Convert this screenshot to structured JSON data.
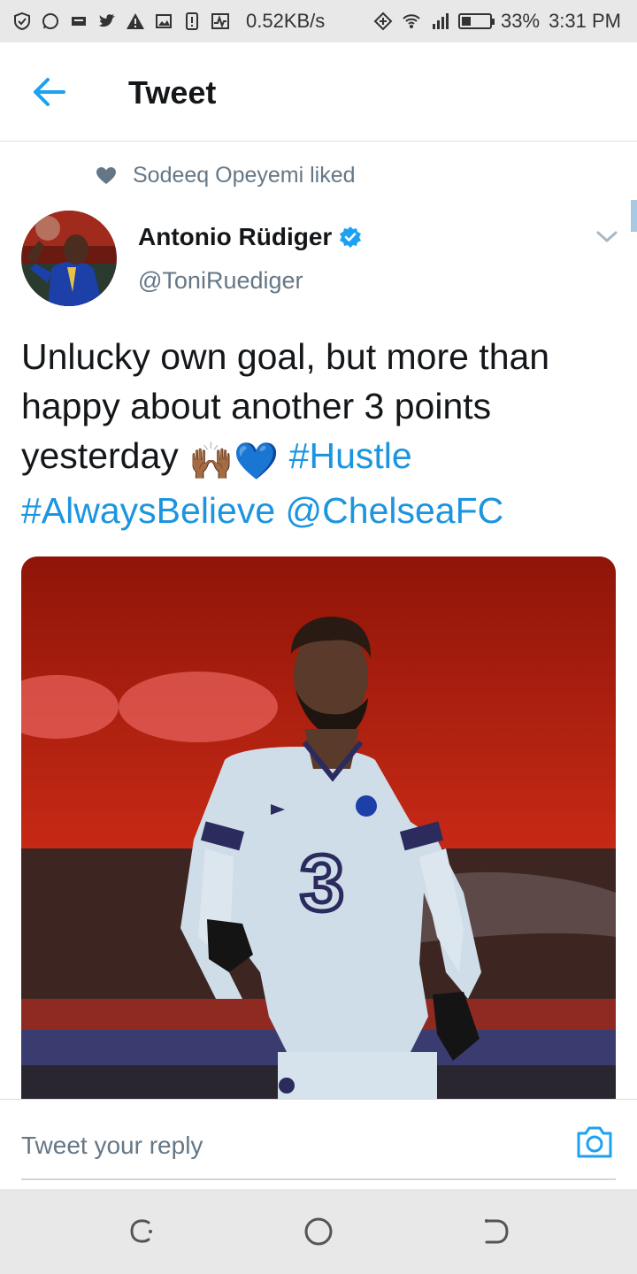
{
  "status_bar": {
    "speed": "0.52KB/s",
    "battery": "33%",
    "time": "3:31 PM",
    "icons": [
      "shield-icon",
      "whatsapp-icon",
      "message-icon",
      "twitter-icon",
      "warning-icon",
      "image-icon",
      "alert-icon",
      "pulse-icon",
      "data-saver-icon",
      "wifi-icon",
      "signal-icon",
      "battery-icon"
    ]
  },
  "header": {
    "title": "Tweet",
    "back_icon": "arrow-left-icon"
  },
  "social_context": {
    "text": "Sodeeq Opeyemi liked",
    "icon": "heart-icon"
  },
  "author": {
    "name": "Antonio Rüdiger",
    "handle": "@ToniRuediger",
    "verified_icon": "verified-badge-icon"
  },
  "tweet": {
    "text_part1": "Unlucky own goal, but more than happy about another 3 points yesterday ",
    "emoji": "🙌🏾💙",
    "hashtag1": "#Hustle",
    "hashtag2": "#AlwaysBelieve",
    "mention": "@ChelseaFC",
    "media_jersey_number": "3"
  },
  "reply": {
    "placeholder": "Tweet your reply",
    "camera_icon": "camera-icon"
  },
  "nav": {
    "icons": [
      "recents-icon",
      "home-icon",
      "back-icon"
    ]
  },
  "colors": {
    "accent": "#1da1f2",
    "link": "#1b95e0",
    "secondary_text": "#657786"
  }
}
